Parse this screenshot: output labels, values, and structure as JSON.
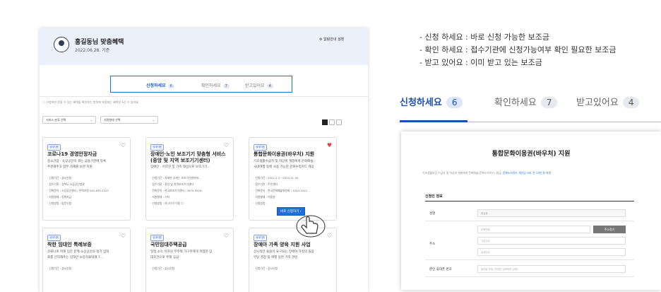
{
  "header": {
    "user_name": "홍길동님 맞춤혜택",
    "date": "2022.06.28. 기준",
    "settings": "알림안내 설정",
    "settings_icon": "gear-icon"
  },
  "tabs": [
    {
      "label": "신청하세요",
      "count": "6"
    },
    {
      "label": "확인하세요",
      "count": "7"
    },
    {
      "label": "받고있어요",
      "count": "4"
    }
  ],
  "notice": "ⓘ 신청하면 받을 수 있는 혜택을 확인하는 항목에 포함되는 혜택은 6건 수 있어요.",
  "filters": [
    {
      "value": "서비스 분류 선택"
    },
    {
      "value": "지원형태 선택"
    }
  ],
  "cards": [
    {
      "badge": "생계지원",
      "title": "코로나19 경영안정자금",
      "desc1": "중소기업 · 소상공인이 겪는 금융기관에 등록",
      "desc2": "추천해주고 업무 자재를 보관 지원",
      "l1": "· 신청기간 : 상시신청",
      "l2": "· 접수기관 : 경북도 소상공인청관",
      "l3": "· 전화문의 : 소상공인센터 / 전력지원 041-635-2223",
      "l4": "· 지원형태 : 정책자금",
      "l5": "· 신청방법 : 방문신청",
      "liked": false
    },
    {
      "badge": "생계지원",
      "title": "장애인·노인 보조기기 맞춤형 서비스",
      "title2": "(중앙 및 지역 보조기기센터)",
      "desc1": "장애인 · 어르신 및 가족 대상으로 보조기기...",
      "l1": "· 신청기간 : 자세한 상세는 보조기기센터에...",
      "l2": "· 접수기관 : 중앙 및 지역보조기기센터",
      "l3": "· 전화문의 : 한국보조기기센터 / 1670-5529",
      "l4": "· 지원형태 : 기타",
      "l5": "· 신청방법 : 하나이이 이동 ☐",
      "liked": false
    },
    {
      "badge": "생계지원",
      "title": "통합문화이용권(바우처) 지원",
      "desc1": "기초생활수급자 및 차상위 계층에게 문화예술,",
      "desc2": "국내여행 등에 사용 가능한 문화누리카드 제공",
      "l1": "· 신청기간 : 2022.2.3.~2022.11.30.",
      "l2": "· 접수기관 : 주민센터",
      "l3": "· 전화문의 : 한국문화예술위원회 / 1544-3412",
      "l4": "· 지원형태 : 이용권",
      "l5": "· 신청방법 :",
      "apply": "바로 신청하기 ›",
      "liked": true
    },
    {
      "badge": "생계지원",
      "title": "착한 임대인 특례보증",
      "desc1": "코로나로 피해 입은 분께 소상공인의 성가 임대",
      "desc2": "료를 인하해주는 임대인 보증자료대해 7...",
      "l1": "· 신청기간 : 상시신청",
      "liked": false
    },
    {
      "badge": "생계지원",
      "title": "국민임대주택공급",
      "desc1": "일정 소득 이하의 무주택 가구주에게 저렴한 임",
      "desc2": "대조건으로 주택 공급",
      "l1": "· 신청기간 : 상시신청",
      "liked": false
    },
    {
      "badge": "생계지원",
      "title": "장애아 가족 양육 지원 사업",
      "desc1": "상시적인 돌봄이 요구되는 장애아 가정의 돌봄",
      "desc2": "부담 경감 및 여행 동반 가족 관련",
      "l1": "· 신청기간 : 상시신청",
      "liked": false
    }
  ],
  "bullets": [
    "- 신청 하세요 : 바로 신청 가능한 보조금",
    "- 확인 하세요 : 접수기관에 신청가능여부 확인 필요한 보조금",
    "- 받고 있어요 : 이미 받고 있는 보조금"
  ],
  "big_tabs": [
    {
      "label": "신청하세요",
      "count": "6"
    },
    {
      "label": "확인하세요",
      "count": "7"
    },
    {
      "label": "받고있어요",
      "count": "4"
    }
  ],
  "detail": {
    "title": "통합문화이용권(바우처) 지원",
    "note": "기초생활보장 수급자 및 차상위 계층에게 문화예술(문화누리카드) 발급,",
    "note_link": "문화누리카드 개인당 1매, 연 10만 원 지원",
    "section": "신청인 정보",
    "fields": [
      {
        "label": "성명",
        "value": "홍길동"
      },
      {
        "label": "",
        "value": "우편번호",
        "button": "주소찾기"
      },
      {
        "label": "주소",
        "value": "기본주소"
      },
      {
        "label": "",
        "value": "상세주소"
      },
      {
        "label": "본인 휴대폰 번호",
        "value": "휴대폰 번호 (숫자만 입력하여 입력)"
      }
    ]
  },
  "colors": {
    "accent": "#1e6fd9",
    "header_bg": "#eaf1fb",
    "heart_active": "#e23b3b"
  }
}
